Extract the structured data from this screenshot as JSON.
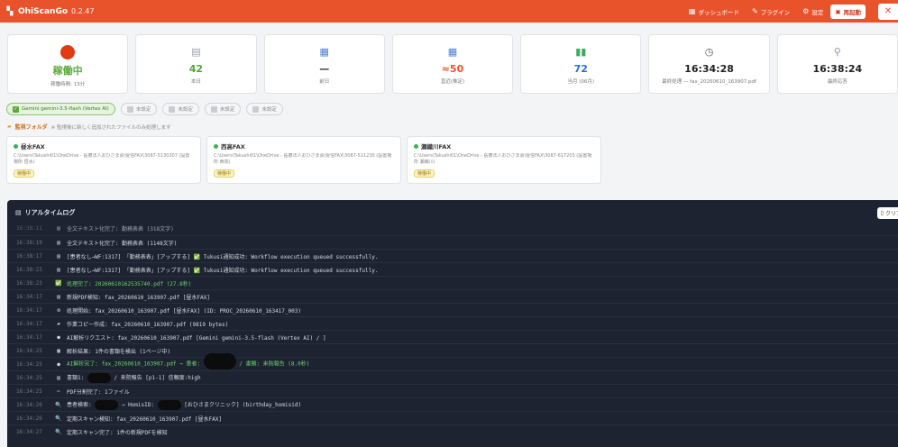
{
  "header": {
    "app_name": "OhiScanGo",
    "version": "0.\u00182.47",
    "nav": [
      {
        "icon": "bar-chart-icon",
        "glyph": "▦",
        "label": "ダッシュボード"
      },
      {
        "icon": "plugin-icon",
        "glyph": "✎",
        "label": "プラグイン"
      },
      {
        "icon": "gear-icon",
        "glyph": "⚙",
        "label": "設定"
      }
    ],
    "restart_label": "再起動",
    "close_label": "✕"
  },
  "stats": [
    {
      "id": "status",
      "icon": "red-status-dot",
      "value": "稼働中",
      "sub": "稼働時間: 13分",
      "color": "#5aaa3a"
    },
    {
      "id": "today",
      "icon": "document-icon",
      "glyph": "📄",
      "value": "42",
      "sub": "本日",
      "color": "#4ba73a"
    },
    {
      "id": "yesterday",
      "icon": "calendar-icon",
      "glyph": "▦",
      "value": "—",
      "sub": "前日",
      "color": "#333333"
    },
    {
      "id": "recent",
      "icon": "calendar-icon",
      "glyph": "▦",
      "value": "≈50",
      "sub": "直近(推定)",
      "color": "#e9532c"
    },
    {
      "id": "month",
      "icon": "chart-icon",
      "glyph": "▮",
      "value": "72",
      "sub": "当月 (06月)",
      "color": "#2a6fd6"
    },
    {
      "id": "last_process",
      "icon": "clock-icon",
      "glyph": "◷",
      "value": "16:34:28",
      "sub": "最終処理 — fax_20260610_163907.pdf",
      "color": "#222222"
    },
    {
      "id": "last_response",
      "icon": "antenna-icon",
      "glyph": "⚲",
      "value": "16:38:24",
      "sub": "最終応答",
      "color": "#222222"
    }
  ],
  "chips": [
    {
      "label": "Gemini gemini-3.5-flash (Vertex AI)",
      "active": true
    },
    {
      "label": "未設定",
      "active": false
    },
    {
      "label": "未設定",
      "active": false
    },
    {
      "label": "未設定",
      "active": false
    },
    {
      "label": "未設定",
      "active": false
    }
  ],
  "folders": {
    "title": "監視フォルダ",
    "note": "※ 監視後に新しく追加されたファイルのみ処理します",
    "items": [
      {
        "name": "昼水FAX",
        "path": "C:\\Users\\Takushi01\\OneDrive - 医療法人おひさま会\\受信FAX\\3087-5130307 (設置場所 昼水)",
        "tag": "稼働中"
      },
      {
        "name": "西高FAX",
        "path": "C:\\Users\\Takushi01\\OneDrive - 医療法人おひさま会\\受信FAX\\3087-511230 (設置場所 西高)",
        "tag": "稼働中"
      },
      {
        "name": "瀬織川FAX",
        "path": "C:\\Users\\Takushi01\\OneDrive - 医療法人おひさま会\\受信FAX\\3087-617203 (設置場所 瀬織川)",
        "tag": "稼働中"
      }
    ]
  },
  "log": {
    "title": "リアルタイムログ",
    "clear_label": "クリア",
    "rows": [
      {
        "time": "16:38:11",
        "icon": "document-icon",
        "glyph": "▤",
        "msg": "全文テキスト化完了: 勤務表表 (318文字)",
        "style": "faded"
      },
      {
        "time": "16:38:19",
        "icon": "document-icon",
        "glyph": "▤",
        "msg": "全文テキスト化完了: 勤務表表 (1148文字)",
        "style": ""
      },
      {
        "time": "16:38:17",
        "icon": "document-icon",
        "glyph": "▤",
        "msg": "[患者なし→WF:1317] 「勤務表表」[アップする] ✅ Tukusi通知成功: Workflow execution queued successfully.",
        "style": ""
      },
      {
        "time": "16:38:23",
        "icon": "document-icon",
        "glyph": "▤",
        "msg": "[患者なし→WF:1317] 「勤務表表」[アップする] ✅ Tukusi通知成功: Workflow execution queued successfully.",
        "style": ""
      },
      {
        "time": "16:38:23",
        "icon": "check-icon",
        "glyph": "✅",
        "msg": "処理完了: 20260610162535740.pdf (27.8秒)",
        "style": "green"
      },
      {
        "time": "16:34:17",
        "icon": "document-icon",
        "glyph": "▤",
        "msg": "新規PDF検知: fax_20260610_163907.pdf [昼水FAX]",
        "style": ""
      },
      {
        "time": "16:34:17",
        "icon": "gear-icon",
        "glyph": "⚙",
        "msg": "処理開始: fax_20260610_163907.pdf [昼水FAX] (ID: PROC_20260610_163417_003)",
        "style": ""
      },
      {
        "time": "16:34:17",
        "icon": "folder-icon",
        "glyph": "▰",
        "msg": "作業コピー作成: fax_20260610_163907.pdf (9819 bytes)",
        "style": ""
      },
      {
        "time": "16:34:17",
        "icon": "brain-icon",
        "glyph": "●",
        "msg": "AI解析リクエスト: fax_20260610_163907.pdf [Gemini gemini-3.5-flash (Vertex AI) / ]",
        "style": ""
      },
      {
        "time": "16:34:25",
        "icon": "list-icon",
        "glyph": "▦",
        "msg": "解析結果: 1件の書類を検出 (1ページ中)",
        "style": ""
      },
      {
        "time": "16:34:25",
        "icon": "brain-icon",
        "glyph": "●",
        "msg": "AI解析完了: fax_20260610_163907.pdf → 患者: ████ / 書類: 来院報告 (8.0秒)",
        "style": "green",
        "redact": "big"
      },
      {
        "time": "16:34:25",
        "icon": "document-icon",
        "glyph": "▤",
        "msg": "書類1: ████ / 来院報告 [p1-1] 信頼度:high",
        "style": "",
        "redact": "small"
      },
      {
        "time": "16:34:25",
        "icon": "scissors-icon",
        "glyph": "✂",
        "msg": "PDF分割完了: 1ファイル",
        "style": ""
      },
      {
        "time": "16:34:26",
        "icon": "search-icon",
        "glyph": "🔍",
        "msg": "患者検索: ████ → HomisID: ████ [おひさまクリニック] (birthday_homisid)",
        "style": "",
        "redact": "small"
      },
      {
        "time": "16:34:26",
        "icon": "search-icon",
        "glyph": "🔍",
        "msg": "定期スキャン検知: fax_20260610_163907.pdf [昼水FAX]",
        "style": ""
      },
      {
        "time": "16:34:27",
        "icon": "search-icon",
        "glyph": "🔍",
        "msg": "定期スキャン完了: 1件の新規PDFを検知",
        "style": ""
      }
    ]
  }
}
